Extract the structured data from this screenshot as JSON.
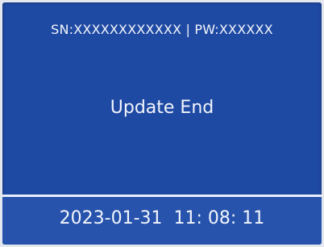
{
  "device": {
    "credentials": "SN:XXXXXXXXXXXX | PW:XXXXXX",
    "message": "Update End",
    "timestamp": "2023-01-31  11: 08: 11"
  },
  "colors": {
    "screen_bg": "#1f4aa3",
    "footer_bg": "#2753ad",
    "text": "#f2f5fb",
    "divider": "#e9eef8"
  }
}
